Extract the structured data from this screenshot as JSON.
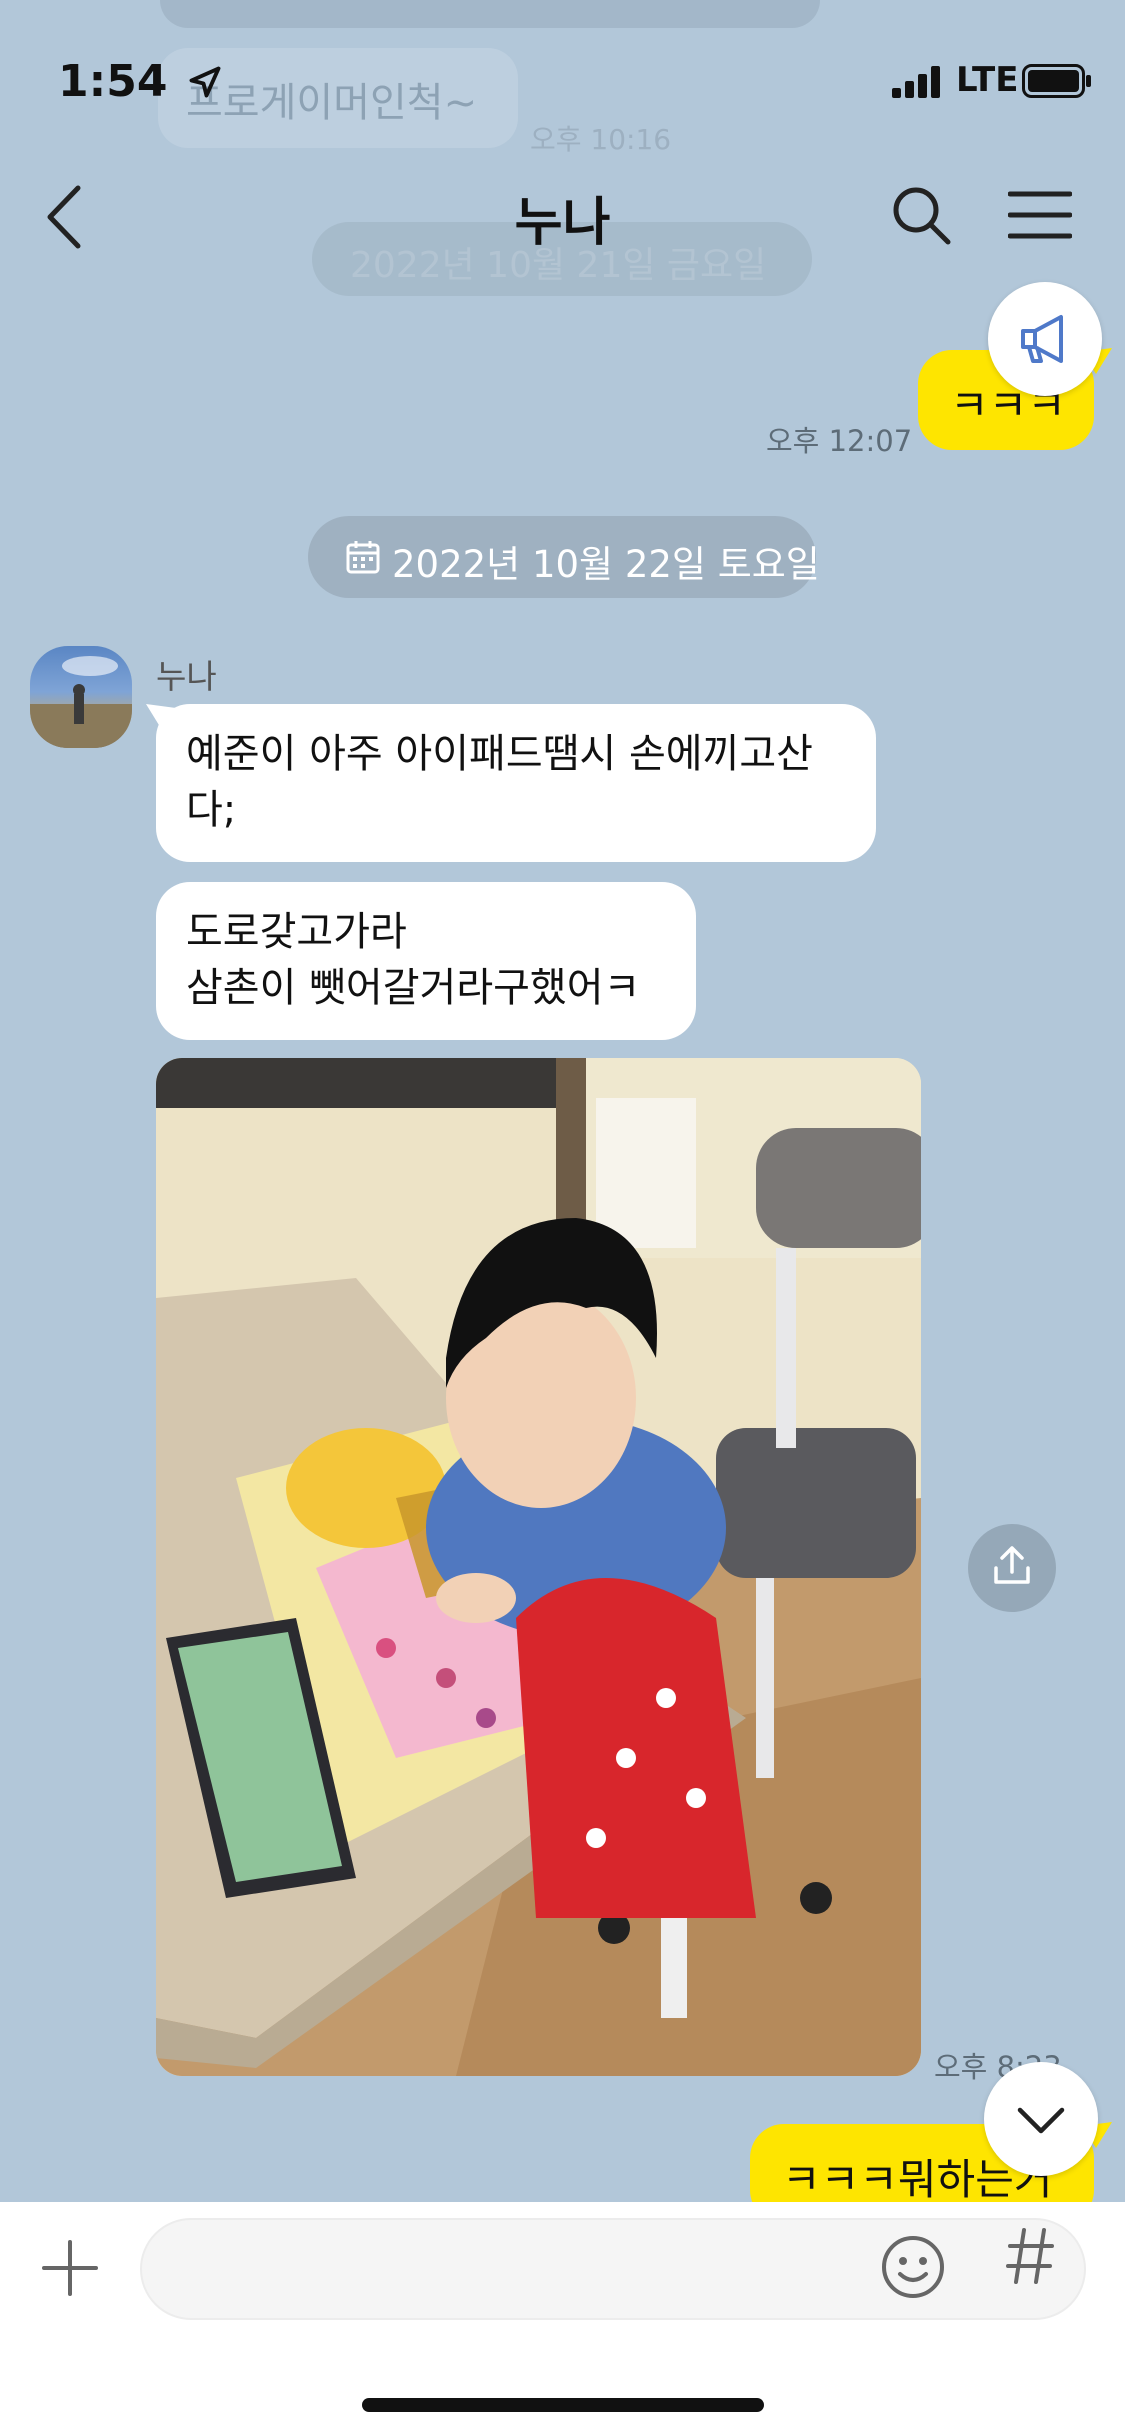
{
  "status_bar": {
    "time": "1:54",
    "network": "LTE"
  },
  "ghost": {
    "message": "프로게이머인척~",
    "time": "오후 10:16",
    "date": "2022년 10월 21일 금요일"
  },
  "header": {
    "title": "누나"
  },
  "messages": {
    "mine1": {
      "text": "ㅋㅋㅋ",
      "time": "오후 12:07"
    },
    "date_divider": "2022년 10월 22일 토요일",
    "sender": "누나",
    "them1": {
      "line1": "예준이 아주 아이패드땜시 손에끼고산",
      "line2": "다;"
    },
    "them2": {
      "line1": "도로갖고가라",
      "line2": "삼촌이 뺏어갈거라구했어ㅋ"
    },
    "photo_time": "오후 8:23",
    "mine2": {
      "text": "ㅋㅋㅋ뭐하는거"
    }
  },
  "colors": {
    "background": "#b2c7d9",
    "my_bubble": "#fee500",
    "their_bubble": "#ffffff"
  },
  "icons": [
    "back-icon",
    "search-icon",
    "menu-icon",
    "megaphone-icon",
    "calendar-icon",
    "share-icon",
    "chevron-down-icon",
    "plus-icon",
    "emoji-icon",
    "hash-icon"
  ]
}
